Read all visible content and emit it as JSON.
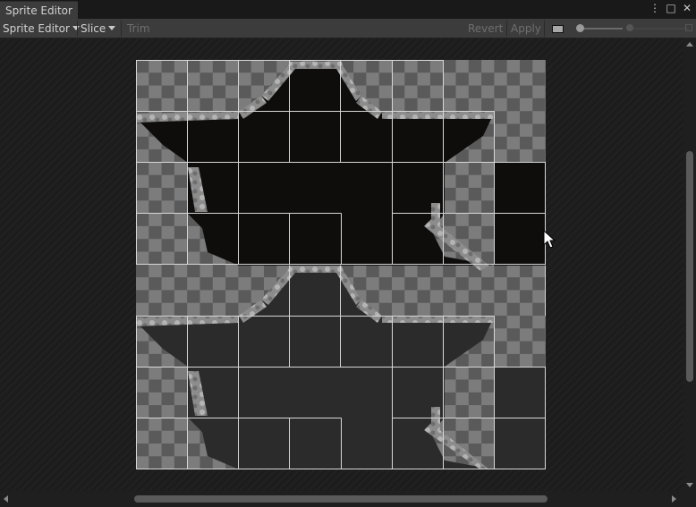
{
  "window": {
    "tab_title": "Sprite Editor",
    "icons": [
      "more-vert-icon",
      "maximize-icon",
      "close-icon"
    ],
    "icon_glyphs": [
      "⋮",
      "□",
      "✕"
    ]
  },
  "toolbar": {
    "mode_dropdown": "Sprite Editor",
    "slice_dropdown": "Slice",
    "trim_label": "Trim",
    "revert_label": "Revert",
    "apply_label": "Apply",
    "zoom_slider_level": 0.05,
    "mip_slider_level": 0.0
  },
  "canvas": {
    "grid_columns": 8,
    "grid_rows": 8,
    "checker_colors": [
      "#7c7c7c",
      "#5a5a5a"
    ],
    "slice_outline_color": "#d8d8d8",
    "sprite_top_color": "#0e0d0c",
    "sprite_bottom_color": "#2b2b2b",
    "rock_color": "#9e9e9e"
  },
  "colors": {
    "background": "#191919",
    "toolbar": "#3c3c3c",
    "scroll_thumb": "#5a5a5a"
  }
}
